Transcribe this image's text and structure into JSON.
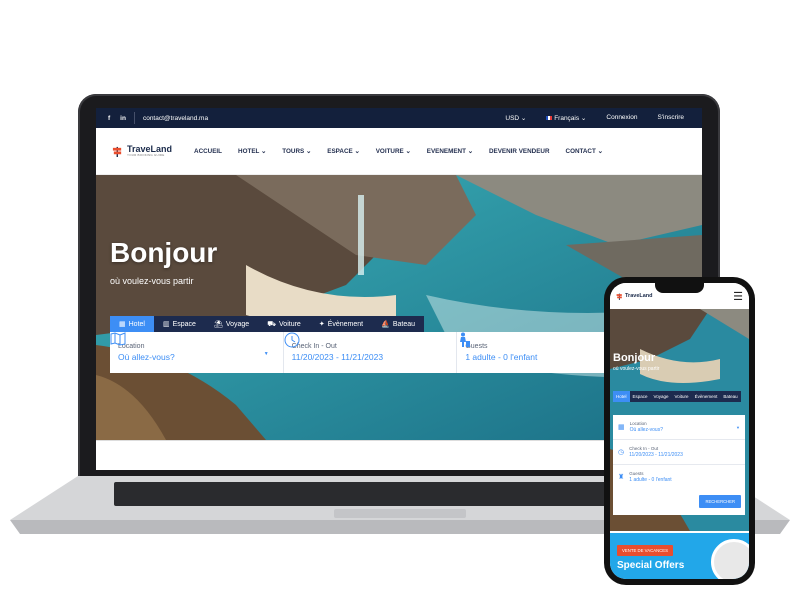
{
  "topbar": {
    "social": [
      "f",
      "in"
    ],
    "email": "contact@traveland.ma",
    "currency": "USD",
    "language": "Français",
    "login": "Connexion",
    "register": "S'inscrire"
  },
  "logo": {
    "name": "TraveLand",
    "tagline": "YOUR BOOKING GUIDE"
  },
  "menu": [
    "ACCUEIL",
    "HOTEL",
    "TOURS",
    "ESPACE",
    "VOITURE",
    "EVENEMENT",
    "DEVENIR VENDEUR",
    "CONTACT"
  ],
  "hero": {
    "title": "Bonjour",
    "subtitle": "où voulez-vous partir"
  },
  "tabs": [
    "Hotel",
    "Espace",
    "Voyage",
    "Voiture",
    "Évènement",
    "Bateau"
  ],
  "search": {
    "location_label": "Location",
    "location_value": "Où allez-vous?",
    "checkin_label": "Check In - Out",
    "checkin_value": "11/20/2023 - 11/21/2023",
    "guests_label": "Guests",
    "guests_value": "1 adulte - 0 l'enfant"
  },
  "phone": {
    "title": "Bonjour",
    "subtitle": "où voulez-vous partir",
    "search_button": "RECHERCHER",
    "promo_badge": "VENTE DE VACANCES",
    "promo_title": "Special Offers"
  },
  "colors": {
    "accent": "#3d8ef5",
    "navy": "#13203c",
    "promo": "#e94e2f"
  }
}
